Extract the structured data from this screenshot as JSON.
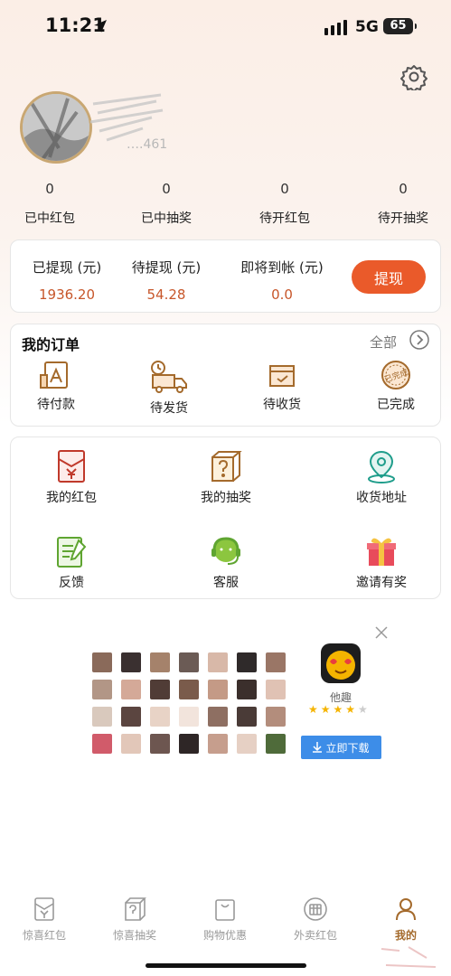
{
  "status_bar": {
    "time": "11:21",
    "network": "5G",
    "battery": "65"
  },
  "profile": {
    "user_id": "….461"
  },
  "stats": [
    {
      "value": "0",
      "label": "已中红包"
    },
    {
      "value": "0",
      "label": "已中抽奖"
    },
    {
      "value": "0",
      "label": "待开红包"
    },
    {
      "value": "0",
      "label": "待开抽奖"
    }
  ],
  "withdraw": {
    "cols": [
      {
        "title": "已提现 (元)",
        "value": "1936.20"
      },
      {
        "title": "待提现 (元)",
        "value": "54.28"
      },
      {
        "title": "即将到帐 (元)",
        "value": "0.0"
      }
    ],
    "button": "提现"
  },
  "orders": {
    "title": "我的订单",
    "all": "全部",
    "items": [
      {
        "label": "待付款",
        "icon": "pending-payment-icon"
      },
      {
        "label": "待发货",
        "icon": "delivery-truck-icon"
      },
      {
        "label": "待收货",
        "icon": "package-box-icon"
      },
      {
        "label": "已完成",
        "icon": "completed-stamp-icon",
        "stamp": "已完成"
      }
    ]
  },
  "services": [
    {
      "label": "我的红包",
      "icon": "red-envelope-icon"
    },
    {
      "label": "我的抽奖",
      "icon": "mystery-box-icon"
    },
    {
      "label": "收货地址",
      "icon": "location-pin-icon"
    },
    {
      "label": "反馈",
      "icon": "feedback-icon"
    },
    {
      "label": "客服",
      "icon": "customer-service-icon"
    },
    {
      "label": "邀请有奖",
      "icon": "gift-icon"
    }
  ],
  "ad": {
    "app_name": "他趣",
    "rating": 4,
    "download": "立即下载"
  },
  "tabbar": [
    {
      "label": "惊喜红包",
      "icon": "red-envelope-icon"
    },
    {
      "label": "惊喜抽奖",
      "icon": "mystery-box-icon"
    },
    {
      "label": "购物优惠",
      "icon": "shopping-bag-icon"
    },
    {
      "label": "外卖红包",
      "icon": "coupon-icon"
    },
    {
      "label": "我的",
      "icon": "user-icon",
      "active": true
    }
  ],
  "colors": {
    "accent": "#ea5a2a",
    "value_text": "#c7562a",
    "tab_active": "#a46a2c",
    "download_blue": "#3d8de8"
  }
}
